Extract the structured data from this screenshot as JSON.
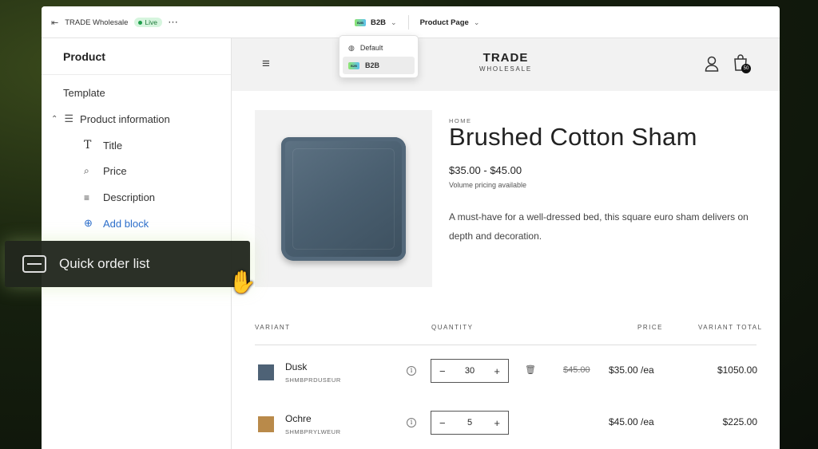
{
  "topbar": {
    "store_name": "TRADE Wholesale",
    "status": "Live",
    "more": "···",
    "market": "B2B",
    "market_badge": "B2B",
    "page": "Product Page"
  },
  "market_dropdown": {
    "options": [
      {
        "label": "Default",
        "icon": "globe-icon",
        "selected": false
      },
      {
        "label": "B2B",
        "icon": "b2b-badge-icon",
        "badge": "B2B",
        "selected": true
      }
    ]
  },
  "sidebar": {
    "title": "Product",
    "template": "Template",
    "section": "Product information",
    "blocks": [
      {
        "label": "Title",
        "icon": "text-icon"
      },
      {
        "label": "Price",
        "icon": "price-tag-icon"
      },
      {
        "label": "Description",
        "icon": "paragraph-icon"
      }
    ],
    "add_block": "Add block"
  },
  "drag_item": {
    "label": "Quick order list",
    "icon": "list-block-icon"
  },
  "storefront": {
    "logo_line1": "TRADE",
    "logo_line2": "WHOLESALE",
    "cart_count": "50",
    "breadcrumb": "HOME",
    "product_title": "Brushed Cotton Sham",
    "price_range": "$35.00 - $45.00",
    "volume_note": "Volume pricing available",
    "description": "A must-have for a well-dressed bed, this square euro sham delivers on depth and decoration."
  },
  "quick_order": {
    "headers": {
      "variant": "VARIANT",
      "quantity": "QUANTITY",
      "price": "PRICE",
      "total": "VARIANT TOTAL"
    },
    "rows": [
      {
        "name": "Dusk",
        "sku": "SHMBPRDUSEUR",
        "qty": "30",
        "old_price": "$45.00",
        "price": "$35.00 /ea",
        "total": "$1050.00",
        "color": "#4e6276"
      },
      {
        "name": "Ochre",
        "sku": "SHMBPRYLWEUR",
        "qty": "5",
        "price": "$45.00 /ea",
        "total": "$225.00",
        "color": "#b98a4a"
      }
    ]
  },
  "colors": {
    "live_green": "#1f9e4b",
    "drag_bg": "#22281e",
    "add_block_blue": "#2c6ecb"
  }
}
